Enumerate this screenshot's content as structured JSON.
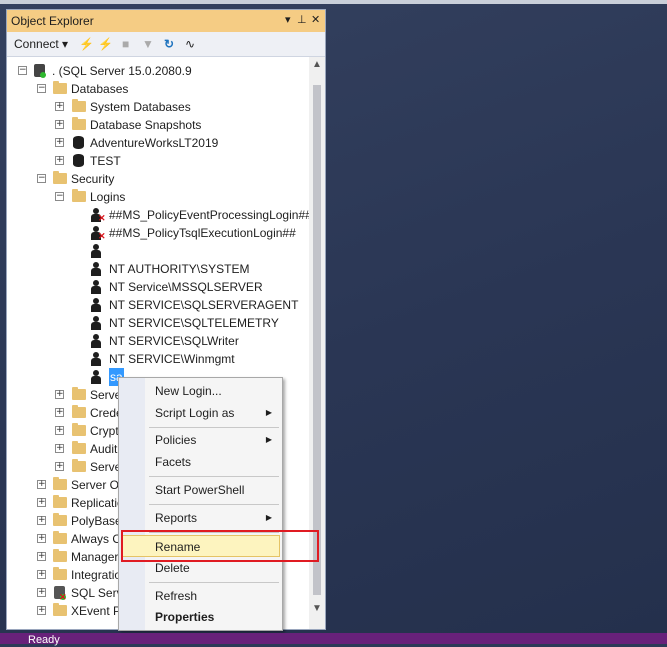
{
  "panel": {
    "title": "Object Explorer",
    "title_controls": [
      "▾",
      "⊥",
      "✕"
    ],
    "toolbar": {
      "connect": "Connect ▾"
    }
  },
  "tree": {
    "server": ". (SQL Server 15.0.2080.9",
    "databases": "Databases",
    "db_children": [
      "System Databases",
      "Database Snapshots",
      "AdventureWorksLT2019",
      "TEST"
    ],
    "security": "Security",
    "logins": "Logins",
    "login_items": [
      "##MS_PolicyEventProcessingLogin##",
      "##MS_PolicyTsqlExecutionLogin##",
      "",
      "NT AUTHORITY\\SYSTEM",
      "NT Service\\MSSQLSERVER",
      "NT SERVICE\\SQLSERVERAGENT",
      "NT SERVICE\\SQLTELEMETRY",
      "NT SERVICE\\SQLWriter",
      "NT SERVICE\\Winmgmt",
      "sa"
    ],
    "security_rest": [
      "Serve",
      "Crede",
      "Crypt",
      "Audit",
      "Serve"
    ],
    "server_rest": [
      "Server Ol",
      "Replicatio",
      "PolyBase",
      "Always O",
      "Manager",
      "Integratio",
      "SQL Serv",
      "XEvent P"
    ]
  },
  "context_menu": {
    "items": [
      "New Login...",
      "Script Login as",
      "Policies",
      "Facets",
      "Start PowerShell",
      "Reports",
      "Rename",
      "Delete",
      "Refresh",
      "Properties"
    ]
  },
  "statusbar": {
    "text": "Ready"
  }
}
